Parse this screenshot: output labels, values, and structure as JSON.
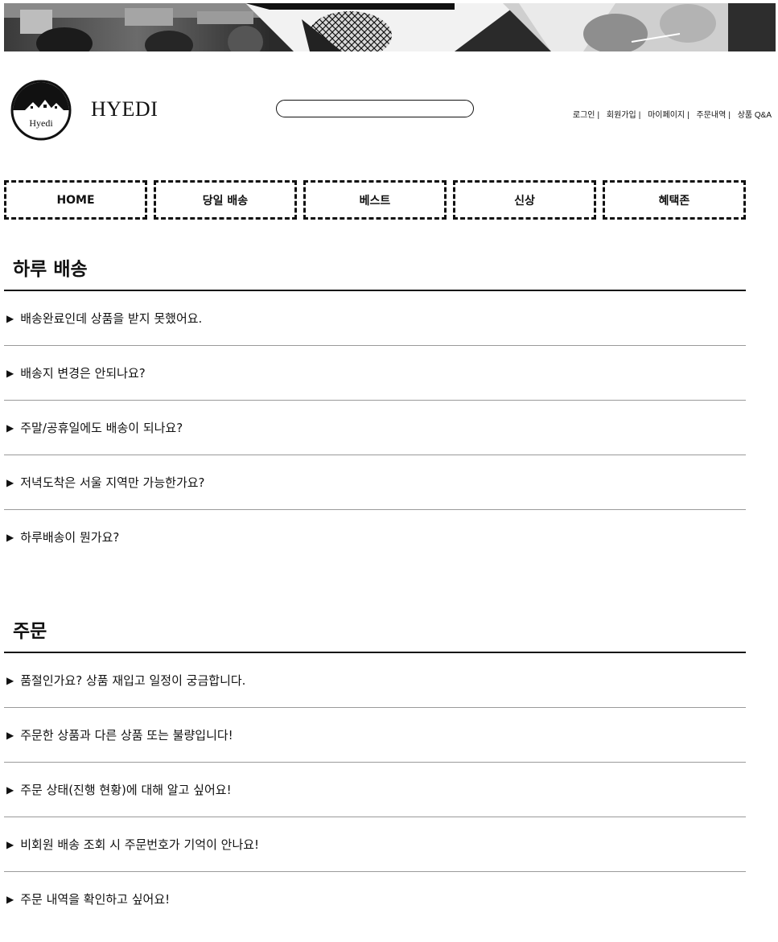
{
  "site": {
    "brand_name": "HYEDI",
    "logo_text": "Hyedi"
  },
  "search": {
    "placeholder": ""
  },
  "utility_links": [
    {
      "label": "로그인"
    },
    {
      "label": "회원가입"
    },
    {
      "label": "마이페이지"
    },
    {
      "label": "주문내역"
    },
    {
      "label": "상품 Q&A"
    }
  ],
  "nav": [
    {
      "label": "HOME"
    },
    {
      "label": "당일 배송"
    },
    {
      "label": "베스트"
    },
    {
      "label": "신상"
    },
    {
      "label": "혜택존"
    }
  ],
  "sections": [
    {
      "title": "하루 배송",
      "items": [
        "배송완료인데 상품을 받지 못했어요.",
        "배송지 변경은 안되나요?",
        "주말/공휴일에도 배송이 되나요?",
        "저녁도착은 서울 지역만 가능한가요?",
        "하루배송이 뭔가요?"
      ]
    },
    {
      "title": "주문",
      "items": [
        "품절인가요? 상품 재입고 일정이 궁금합니다.",
        "주문한 상품과 다른 상품 또는 불량입니다!",
        "주문 상태(진행 현황)에 대해 알고 싶어요!",
        "비회원 배송 조회 시 주문번호가 기억이 안나요!",
        "주문 내역을 확인하고 싶어요!"
      ]
    }
  ],
  "icons": {
    "faq_arrow": "▶"
  },
  "colors": {
    "text": "#111111",
    "divider": "#9a9a9a",
    "background": "#ffffff"
  }
}
